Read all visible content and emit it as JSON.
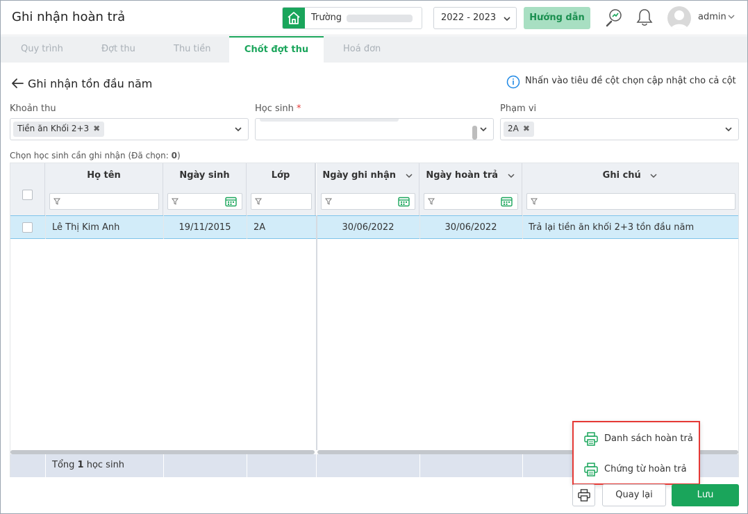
{
  "header": {
    "title": "Ghi nhận hoàn trả",
    "school_label": "Trường",
    "year": "2022 - 2023",
    "guide_button": "Hướng dẫn",
    "user": "admin"
  },
  "tabs": [
    "Quy trình",
    "Đợt thu",
    "Thu tiền",
    "Chốt đợt thu",
    "Hoá đơn"
  ],
  "page": {
    "subtitle": "Ghi nhận tồn đầu năm",
    "hint": "Nhấn vào tiêu đề cột chọn cập nhật cho cả cột"
  },
  "filters": {
    "khoan_thu_label": "Khoản thu",
    "khoan_thu_chip": "Tiền ăn Khối 2+3",
    "hoc_sinh_label": "Học sinh",
    "required_mark": "*",
    "pham_vi_label": "Phạm vi",
    "pham_vi_chip": "2A",
    "chip_remove": "✖"
  },
  "selection": {
    "prefix": "Chọn học sinh cần ghi nhận (Đã chọn: ",
    "count": "0",
    "suffix": ")"
  },
  "grid": {
    "columns": [
      "Họ tên",
      "Ngày sinh",
      "Lớp",
      "Ngày ghi nhận",
      "Ngày hoàn trả",
      "Ghi chú"
    ],
    "rows": [
      {
        "ho_ten": "Lê Thị Kim Anh",
        "ngay_sinh": "19/11/2015",
        "lop": "2A",
        "ngay_ghi_nhan": "30/06/2022",
        "ngay_hoan_tra": "30/06/2022",
        "ghi_chu": "Trả lại tiền ăn khối 2+3 tồn đầu năm"
      }
    ],
    "footer_prefix": "Tổng ",
    "footer_count": "1",
    "footer_suffix": " học sinh"
  },
  "print_menu": {
    "item1": "Danh sách hoàn trả",
    "item2": "Chứng từ hoàn trả"
  },
  "actions": {
    "back": "Quay lại",
    "save": "Lưu"
  },
  "colors": {
    "accent": "#1aa55b",
    "selected_row": "#d2ecf9",
    "popup_border": "#e53935"
  }
}
